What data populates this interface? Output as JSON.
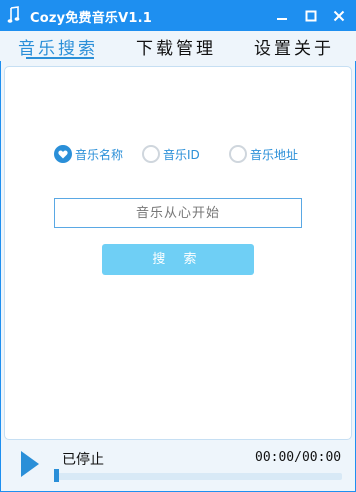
{
  "window": {
    "title": "Cozy免费音乐V1.1"
  },
  "tabs": [
    {
      "label": "音乐搜索",
      "active": true
    },
    {
      "label": "下载管理",
      "active": false
    },
    {
      "label": "设置关于",
      "active": false
    }
  ],
  "search": {
    "modes": [
      {
        "label": "音乐名称",
        "checked": true
      },
      {
        "label": "音乐ID",
        "checked": false
      },
      {
        "label": "音乐地址",
        "checked": false
      }
    ],
    "placeholder": "音乐从心开始",
    "button_label": "搜 索"
  },
  "player": {
    "status": "已停止",
    "time": "00:00/00:00",
    "progress": 0
  },
  "colors": {
    "accent": "#1e8ff0",
    "tab_active": "#2a8fd8",
    "button": "#6fcff5"
  }
}
